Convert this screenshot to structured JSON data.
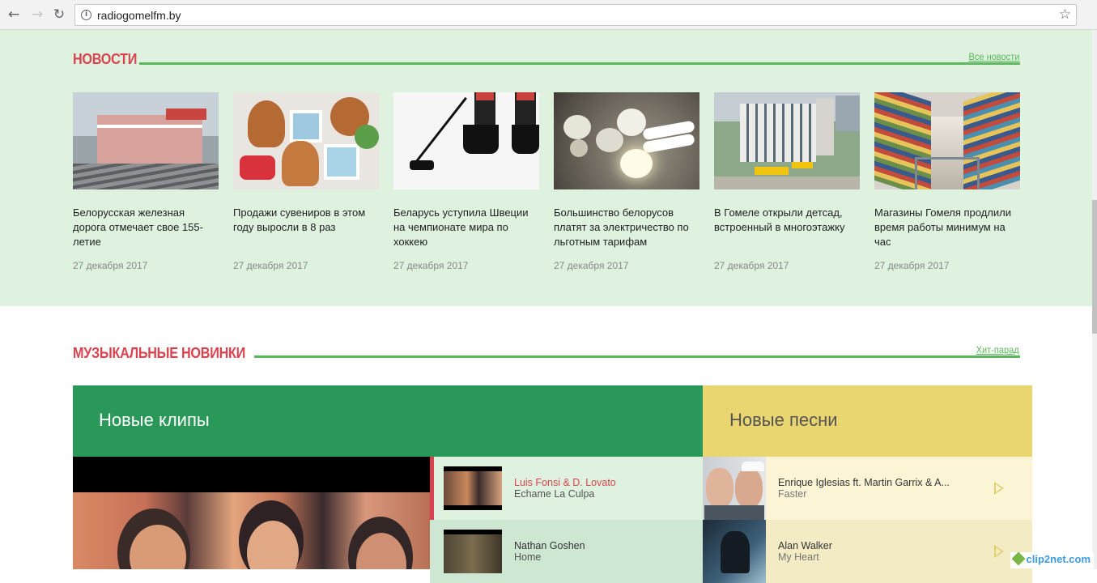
{
  "browser": {
    "url": "radiogomelfm.by"
  },
  "news": {
    "title": "НОВОСТИ",
    "all_link": "Все новости",
    "items": [
      {
        "title": "Белорусская железная дорога отмечает свое 155-летие",
        "date": "27 декабря 2017"
      },
      {
        "title": "Продажи сувениров в этом году выросли в 8 раз",
        "date": "27 декабря 2017"
      },
      {
        "title": "Беларусь уступила Швеции на чемпионате мира по хоккею",
        "date": "27 декабря 2017"
      },
      {
        "title": "Большинство белорусов платят за электричество по льготным тарифам",
        "date": "27 декабря 2017"
      },
      {
        "title": "В Гомеле открыли детсад, встроенный в многоэтажку",
        "date": "27 декабря 2017"
      },
      {
        "title": "Магазины Гомеля продлили время работы минимум на час",
        "date": "27 декабря 2017"
      }
    ]
  },
  "music": {
    "title": "МУЗЫКАЛЬНЫЕ НОВИНКИ",
    "chart_link": "Хит-парад",
    "clips_heading": "Новые клипы",
    "songs_heading": "Новые песни",
    "clips": [
      {
        "artist": "Luis Fonsi & D. Lovato",
        "song": "Echame La Culpa"
      },
      {
        "artist": "Nathan Goshen",
        "song": "Home"
      }
    ],
    "songs": [
      {
        "artist": "Enrique Iglesias ft. Martin Garrix & A...",
        "song": "Faster"
      },
      {
        "artist": "Alan Walker",
        "song": "My Heart"
      }
    ]
  },
  "watermark": "clip2net.com"
}
